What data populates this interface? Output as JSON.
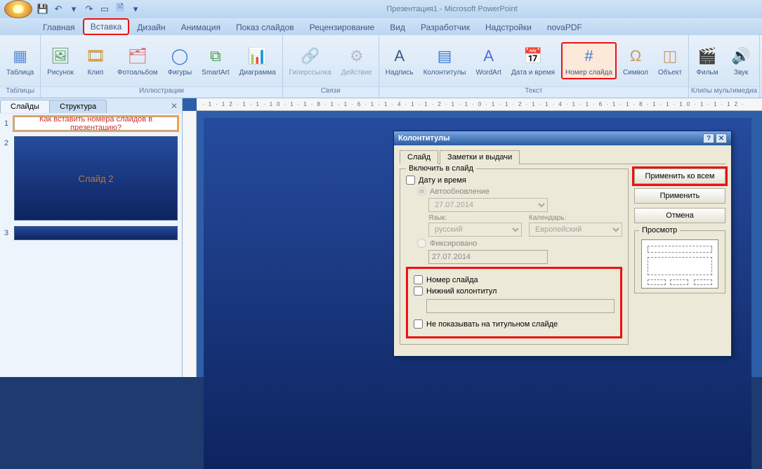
{
  "app": {
    "title": "Презентация1 - Microsoft PowerPoint"
  },
  "qat": {
    "save": "💾",
    "undo": "↶",
    "redo": "↷",
    "down": "▾",
    "new": "▭",
    "print": "🗎",
    "more": "▾"
  },
  "tabs": [
    "Главная",
    "Вставка",
    "Дизайн",
    "Анимация",
    "Показ слайдов",
    "Рецензирование",
    "Вид",
    "Разработчик",
    "Надстройки",
    "novaPDF"
  ],
  "ribbon": {
    "groups": [
      {
        "label": "Таблицы",
        "items": [
          {
            "name": "table",
            "label": "Таблица",
            "icon": "▦"
          }
        ]
      },
      {
        "label": "Иллюстрации",
        "items": [
          {
            "name": "picture",
            "label": "Рисунок",
            "icon": "🖼"
          },
          {
            "name": "clip",
            "label": "Клип",
            "icon": "🎞"
          },
          {
            "name": "album",
            "label": "Фотоальбом",
            "icon": "🗂"
          },
          {
            "name": "shapes",
            "label": "Фигуры",
            "icon": "◯"
          },
          {
            "name": "smartart",
            "label": "SmartArt",
            "icon": "⧉"
          },
          {
            "name": "chart",
            "label": "Диаграмма",
            "icon": "📊"
          }
        ]
      },
      {
        "label": "Связи",
        "items": [
          {
            "name": "hyperlink",
            "label": "Гиперссылка",
            "icon": "🔗"
          },
          {
            "name": "action",
            "label": "Действие",
            "icon": "⚙"
          }
        ]
      },
      {
        "label": "Текст",
        "items": [
          {
            "name": "textbox",
            "label": "Надпись",
            "icon": "A"
          },
          {
            "name": "headerfooter",
            "label": "Колонтитулы",
            "icon": "▤"
          },
          {
            "name": "wordart",
            "label": "WordArt",
            "icon": "A"
          },
          {
            "name": "datetime",
            "label": "Дата и время",
            "icon": "📅"
          },
          {
            "name": "slidenumber",
            "label": "Номер слайда",
            "icon": "#"
          },
          {
            "name": "symbol",
            "label": "Символ",
            "icon": "Ω"
          },
          {
            "name": "object",
            "label": "Объект",
            "icon": "◫"
          }
        ]
      },
      {
        "label": "Клипы мультимедиа",
        "items": [
          {
            "name": "movie",
            "label": "Фильм",
            "icon": "🎬"
          },
          {
            "name": "sound",
            "label": "Звук",
            "icon": "🔊"
          }
        ]
      }
    ]
  },
  "pane": {
    "tab_slides": "Слайды",
    "tab_outline": "Структура"
  },
  "thumbs": [
    {
      "n": "1",
      "text": "Как вставить номера слайдов в презентацию?"
    },
    {
      "n": "2",
      "text": "Слайд 2"
    },
    {
      "n": "3",
      "text": ""
    }
  ],
  "ruler_marks": "·1·12·1·1·10·1·1·8·1·1·6·1·1·4·1·1·2·1·1·0·1·1·2·1·1·4·1·1·6·1·1·8·1·1·10·1·1·12·",
  "dialog": {
    "title": "Колонтитулы",
    "tab_slide": "Слайд",
    "tab_notes": "Заметки и выдачи",
    "include_legend": "Включить в слайд",
    "datetime": "Дату и время",
    "auto": "Автообновление",
    "date_auto": "27.07.2014",
    "lang_label": "Язык:",
    "lang": "русский",
    "cal_label": "Календарь:",
    "cal": "Европейский",
    "fixed": "Фиксировано",
    "date_fixed": "27.07.2014",
    "slidenum": "Номер слайда",
    "footer": "Нижний колонтитул",
    "notitle": "Не показывать на титульном слайде",
    "apply_all": "Применить ко всем",
    "apply": "Применить",
    "cancel": "Отмена",
    "preview": "Просмотр"
  }
}
